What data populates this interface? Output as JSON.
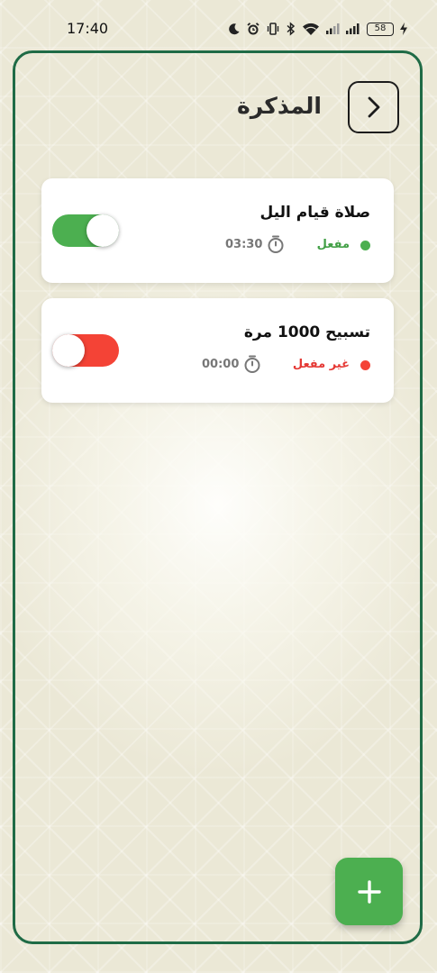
{
  "status_bar": {
    "time": "17:40",
    "battery": "58",
    "icons": [
      "moon-icon",
      "alarm-icon",
      "vibrate-icon",
      "bluetooth-icon",
      "wifi-icon",
      "signal-icon",
      "signal-icon",
      "battery-icon",
      "charging-icon"
    ]
  },
  "header": {
    "title": "المذكرة",
    "back_icon": "chevron-right-icon"
  },
  "reminders": [
    {
      "title": "صلاة قيام اليل",
      "status": "مفعل",
      "time": "03:30",
      "enabled": true
    },
    {
      "title": "تسبيح 1000 مرة",
      "status": "غير مفعل",
      "time": "00:00",
      "enabled": false
    }
  ],
  "fab": {
    "icon": "plus-icon"
  },
  "colors": {
    "frame_border": "#1f6b46",
    "enabled": "#4caf50",
    "disabled": "#f44336",
    "enabled_text": "#43a047",
    "disabled_text": "#e53935",
    "time_text": "#777777",
    "fab": "#4caf50"
  }
}
